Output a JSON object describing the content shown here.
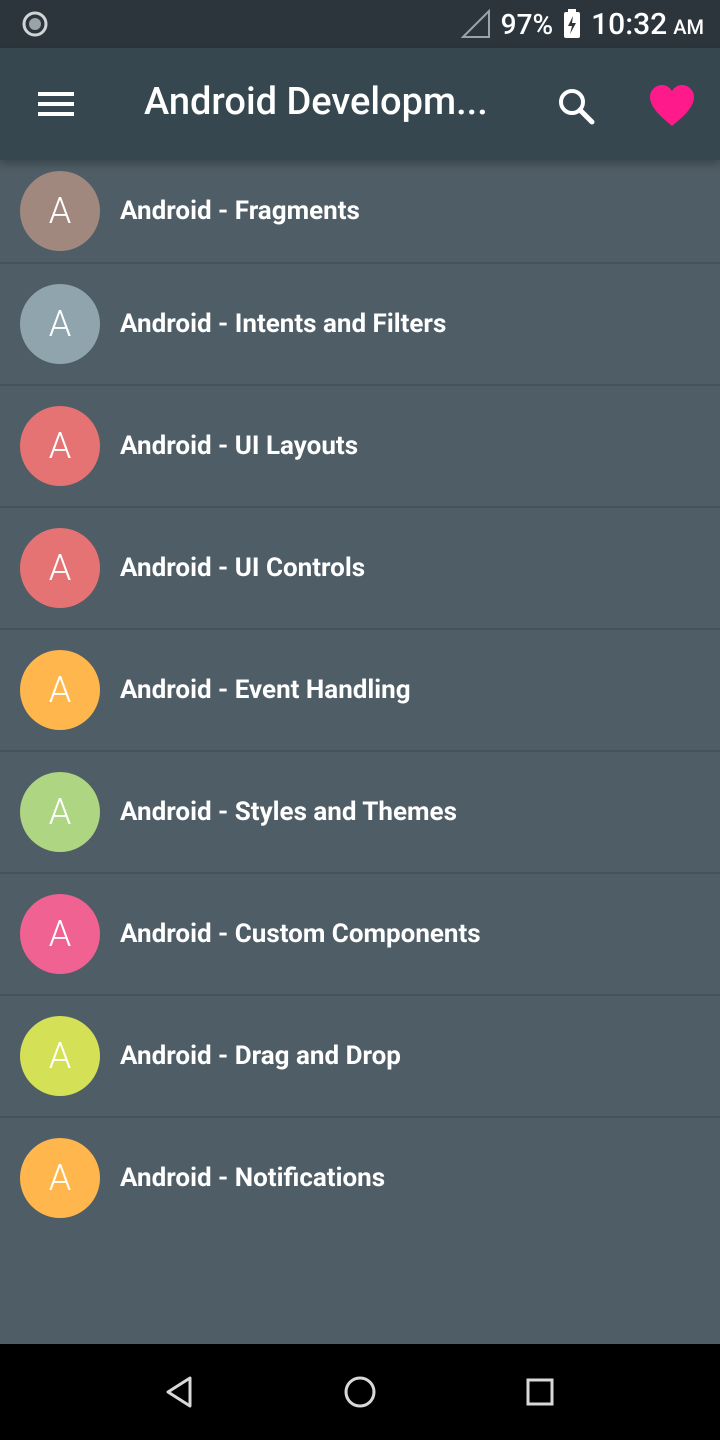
{
  "status_bar": {
    "battery": "97%",
    "time": "10:32",
    "ampm": "AM"
  },
  "app_bar": {
    "title": "Android Developm...",
    "icons": [
      "menu-icon",
      "search-icon",
      "heart-icon"
    ],
    "heart_color": "#ff1a8c"
  },
  "topics": [
    {
      "avatar_letter": "A",
      "title": "Android - Fragments",
      "color": "#a1887f"
    },
    {
      "avatar_letter": "A",
      "title": "Android - Intents and Filters",
      "color": "#90a4ae"
    },
    {
      "avatar_letter": "A",
      "title": "Android - UI Layouts",
      "color": "#e57373"
    },
    {
      "avatar_letter": "A",
      "title": "Android - UI Controls",
      "color": "#e57373"
    },
    {
      "avatar_letter": "A",
      "title": "Android - Event Handling",
      "color": "#ffb74d"
    },
    {
      "avatar_letter": "A",
      "title": "Android - Styles and Themes",
      "color": "#aed581"
    },
    {
      "avatar_letter": "A",
      "title": "Android - Custom Components",
      "color": "#f06292"
    },
    {
      "avatar_letter": "A",
      "title": "Android - Drag and Drop",
      "color": "#d4e157"
    },
    {
      "avatar_letter": "A",
      "title": "Android - Notifications",
      "color": "#ffb74d"
    }
  ],
  "nav_bar": {
    "icons": [
      "back-icon",
      "home-icon",
      "recents-icon"
    ]
  }
}
